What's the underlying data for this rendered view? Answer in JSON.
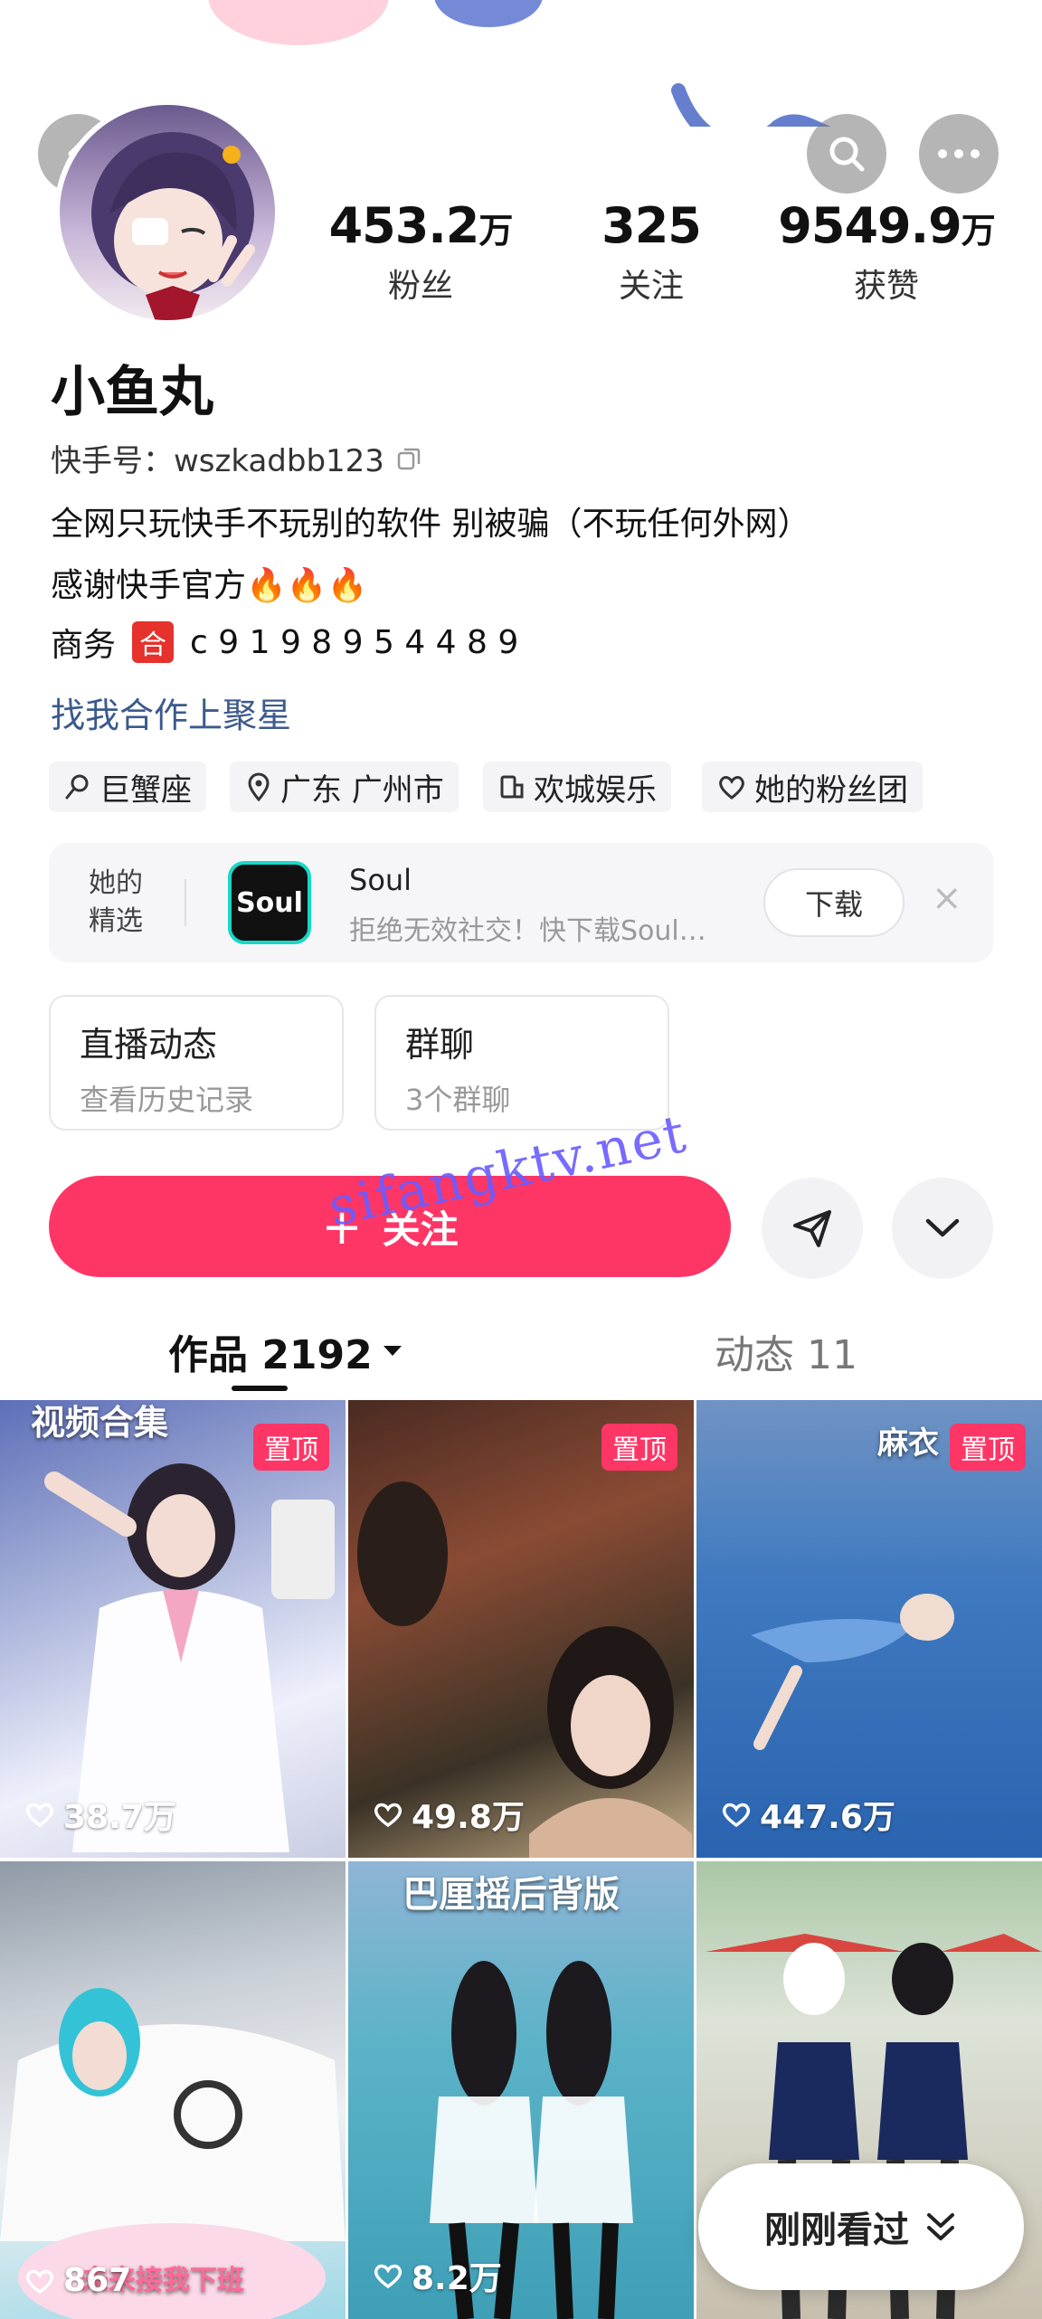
{
  "profile": {
    "name": "小鱼丸",
    "id_label": "快手号：wszkadbb123",
    "bio_line1": "全网只玩快手不玩别的软件 别被骗（不玩任何外网）",
    "bio_line2": "感谢快手官方🔥🔥🔥",
    "business_prefix": "商务",
    "business_badge": "合",
    "business_contact": "c 9 1 9 8 9 5 4 4 8 9",
    "collab_link": "找我合作上聚星"
  },
  "stats": [
    {
      "num": "453.2",
      "unit": "万",
      "label": "粉丝"
    },
    {
      "num": "325",
      "unit": "",
      "label": "关注"
    },
    {
      "num": "9549.9",
      "unit": "万",
      "label": "获赞"
    }
  ],
  "tags": [
    {
      "icon": "zodiac-icon",
      "label": "巨蟹座"
    },
    {
      "icon": "location-icon",
      "label": "广东 广州市"
    },
    {
      "icon": "building-icon",
      "label": "欢城娱乐"
    },
    {
      "icon": "heart-icon",
      "label": "她的粉丝团"
    }
  ],
  "promo": {
    "side_label_1": "她的",
    "side_label_2": "精选",
    "app_logo_text": "Soul",
    "app_name": "Soul",
    "app_desc": "拒绝无效社交！快下载Soul…",
    "download_label": "下载",
    "close_glyph": "×"
  },
  "cards": [
    {
      "title": "直播动态",
      "sub": "查看历史记录"
    },
    {
      "title": "群聊",
      "sub": "3个群聊"
    }
  ],
  "actions": {
    "follow_plus": "+",
    "follow_label": "关注"
  },
  "tabs": {
    "works_label": "作品 2192",
    "moments_label": "动态 11"
  },
  "watermark": "sifangktv.net",
  "grid": [
    {
      "likes": "38.7万",
      "pinned": "置顶",
      "title": "视频合集"
    },
    {
      "likes": "49.8万",
      "pinned": "置顶",
      "title": ""
    },
    {
      "likes": "447.6万",
      "pinned": "置顶",
      "title": "麻衣"
    },
    {
      "likes": "867",
      "pinned": "",
      "title": "",
      "caption": "未来接我下班"
    },
    {
      "likes": "8.2万",
      "pinned": "",
      "title": "巴厘摇后背版"
    },
    {
      "likes": "",
      "pinned": "",
      "title": ""
    }
  ],
  "seen_button": "刚刚看过",
  "colors": {
    "accent": "#fe3666",
    "link": "#3b5a8c"
  }
}
